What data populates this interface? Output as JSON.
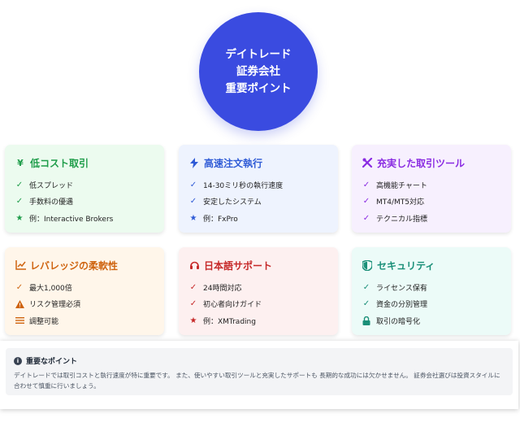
{
  "hero": {
    "lines": [
      "デイトレード",
      "証券会社",
      "重要ポイント"
    ]
  },
  "cards": [
    {
      "title": "低コスト取引",
      "color": "#1f9d4a",
      "items": [
        "低スプレッド",
        "手数料の優遇",
        "例：Interactive Brokers"
      ]
    },
    {
      "title": "高速注文執行",
      "color": "#2f5bd6",
      "items": [
        "14-30ミリ秒の執行速度",
        "安定したシステム",
        "例：FxPro"
      ]
    },
    {
      "title": "充実した取引ツール",
      "color": "#8a2be2",
      "items": [
        "高機能チャート",
        "MT4/MT5対応",
        "テクニカル指標"
      ]
    },
    {
      "title": "レバレッジの柔軟性",
      "color": "#cf6410",
      "items": [
        "最大1,000倍",
        "リスク管理必須",
        "調整可能"
      ]
    },
    {
      "title": "日本語サポート",
      "color": "#c62828",
      "items": [
        "24時間対応",
        "初心者向けガイド",
        "例：XMTrading"
      ]
    },
    {
      "title": "セキュリティ",
      "color": "#1a8f78",
      "items": [
        "ライセンス保有",
        "資金の分別管理",
        "取引の暗号化"
      ]
    }
  ],
  "notice": {
    "title": "重要なポイント",
    "text": "デイトレードでは取引コストと執行速度が特に重要です。 また、使いやすい取引ツールと充実したサポートも 長期的な成功には欠かせません。 証券会社選びは投資スタイルに合わせて慎重に行いましょう。"
  }
}
